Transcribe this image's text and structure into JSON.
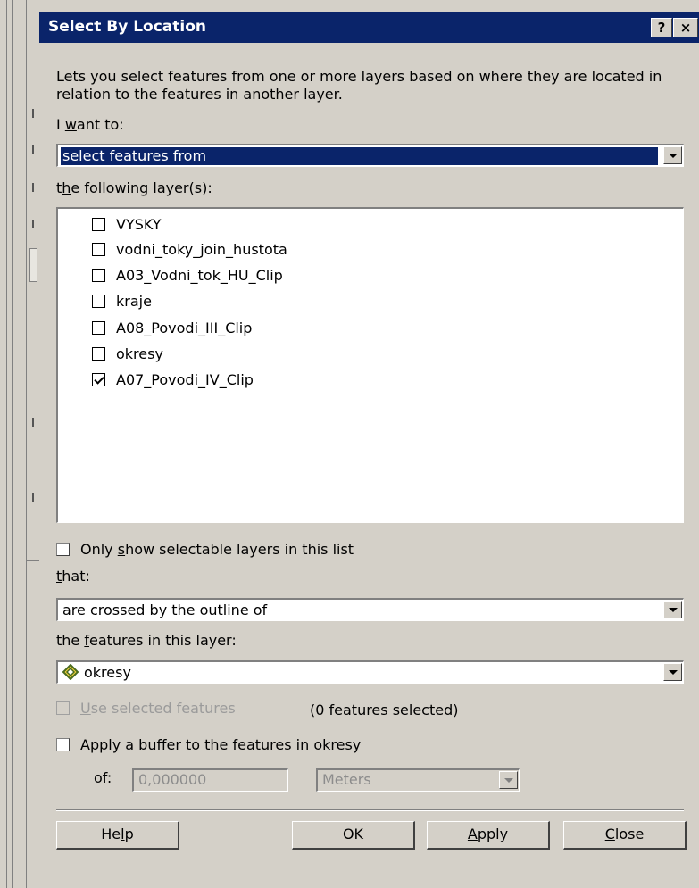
{
  "dialog": {
    "title": "Select By Location",
    "help_glyph": "?",
    "close_glyph": "×",
    "description": "Lets you select features from one or more layers based on where they are located in relation to the features in another layer.",
    "want_to_label": {
      "pre": "I ",
      "mnemonic": "w",
      "post": "ant to:"
    },
    "method_value": "select features from",
    "layers_label": {
      "pre": "t",
      "mnemonic": "h",
      "post": "e following layer(s):"
    },
    "layers": [
      {
        "name": "VYSKY",
        "checked": false
      },
      {
        "name": "vodni_toky_join_hustota",
        "checked": false
      },
      {
        "name": "A03_Vodni_tok_HU_Clip",
        "checked": false
      },
      {
        "name": "kraje",
        "checked": false
      },
      {
        "name": "A08_Povodi_III_Clip",
        "checked": false
      },
      {
        "name": "okresy",
        "checked": false
      },
      {
        "name": "A07_Povodi_IV_Clip",
        "checked": true
      }
    ],
    "only_selectable": {
      "pre": "Only ",
      "mnemonic": "s",
      "post": "how selectable layers in this list",
      "checked": false
    },
    "that_label": {
      "pre": "",
      "mnemonic": "t",
      "post": "hat:"
    },
    "relation_value": "are crossed by the outline of",
    "features_label": {
      "pre": "the ",
      "mnemonic": "f",
      "post": "eatures in this layer:"
    },
    "source_layer": "okresy",
    "use_selected": {
      "pre": "",
      "mnemonic": "U",
      "post": "se selected features",
      "checked": false,
      "enabled": false
    },
    "selected_count": "(0 features selected)",
    "buffer": {
      "pre": "A",
      "mnemonic": "p",
      "post": "ply a buffer to the features in okresy",
      "checked": false
    },
    "of_label": {
      "pre": "",
      "mnemonic": "o",
      "post": "f:"
    },
    "buffer_distance": "0,000000",
    "buffer_units": "Meters",
    "buttons": {
      "help": {
        "pre": "He",
        "mnemonic": "l",
        "post": "p"
      },
      "ok": "OK",
      "apply": {
        "pre": "",
        "mnemonic": "A",
        "post": "pply"
      },
      "close": {
        "pre": "",
        "mnemonic": "C",
        "post": "lose"
      }
    }
  },
  "colors": {
    "title_bar": "#0a246a",
    "face": "#d4d0c8",
    "selection": "#0a246a"
  },
  "icons": {
    "layer_icon": "polygon-layer-icon"
  }
}
